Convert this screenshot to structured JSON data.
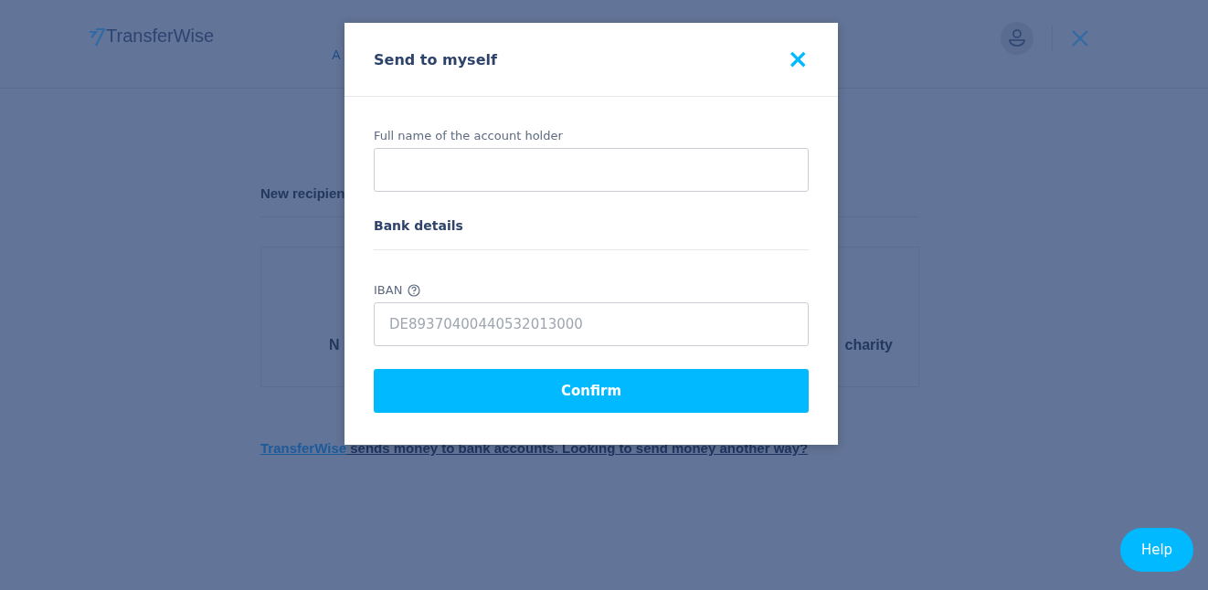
{
  "header": {
    "logo": "TransferWise",
    "nav_item": "A"
  },
  "page": {
    "heading": "New recipien",
    "card_left": "N",
    "card_right": "charity",
    "note": {
      "link": "TransferWise",
      "text": " sends money to bank accounts. Looking to send money another way?"
    }
  },
  "dialog": {
    "title": "Send to myself",
    "close": "×",
    "fields": [
      {
        "kind": "input",
        "label": "Full name of the account holder",
        "help": false
      },
      {
        "kind": "section",
        "label": "Bank details"
      },
      {
        "kind": "input",
        "label": "IBAN",
        "help": true,
        "placeholder": "DE89370400440532013000"
      }
    ],
    "confirm": "Confirm"
  },
  "help_button": "Help"
}
